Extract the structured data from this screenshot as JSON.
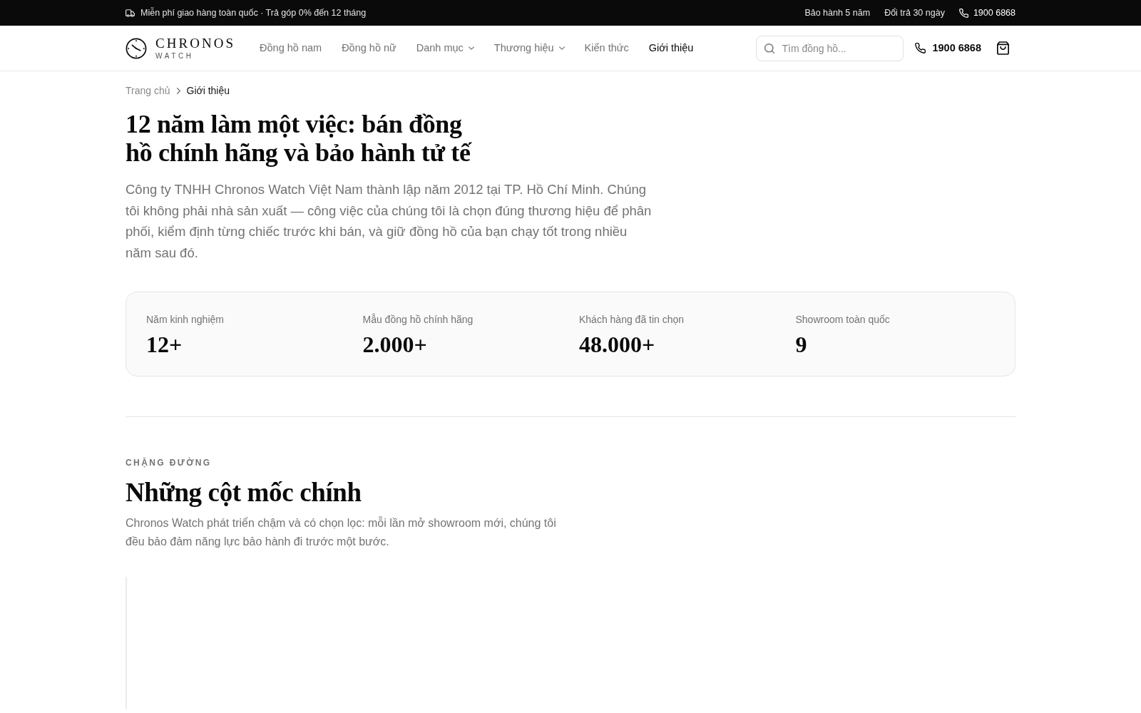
{
  "top_bar": {
    "promo": "Miễn phí giao hàng toàn quốc · Trả góp 0% đến 12 tháng",
    "links": [
      "Bảo hành 5 năm",
      "Đổi trả 30 ngày"
    ],
    "phone": "1900 6868"
  },
  "header": {
    "logo": {
      "name": "CHRONOS",
      "tagline": "WATCH"
    },
    "nav": [
      {
        "label": "Đồng hồ nam",
        "kind": "link",
        "selected": false
      },
      {
        "label": "Đồng hồ nữ",
        "kind": "link",
        "selected": false
      },
      {
        "label": "Danh mục",
        "kind": "dropdown",
        "selected": false
      },
      {
        "label": "Thương hiệu",
        "kind": "dropdown",
        "selected": false
      },
      {
        "label": "Kiến thức",
        "kind": "link",
        "selected": false
      },
      {
        "label": "Giới thiệu",
        "kind": "link",
        "selected": true
      }
    ],
    "search": {
      "placeholder": "Tìm đồng hồ..."
    },
    "phone": "1900 6868"
  },
  "breadcrumb": [
    {
      "label": "Trang chủ",
      "current": false
    },
    {
      "label": "Giới thiệu",
      "current": true
    }
  ],
  "hero": {
    "title": "12 năm làm một việc: bán đồng hồ chính hãng và bảo hành tử tế",
    "intro": "Công ty TNHH Chronos Watch Việt Nam thành lập năm 2012 tại TP. Hồ Chí Minh. Chúng tôi không phải nhà sản xuất — công việc của chúng tôi là chọn đúng thương hiệu để phân phối, kiểm định từng chiếc trước khi bán, và giữ đồng hồ của bạn chạy tốt trong nhiều năm sau đó."
  },
  "stats": [
    {
      "label": "Năm kinh nghiệm",
      "value": "12+"
    },
    {
      "label": "Mẫu đồng hồ chính hãng",
      "value": "2.000+"
    },
    {
      "label": "Khách hàng đã tin chọn",
      "value": "48.000+"
    },
    {
      "label": "Showroom toàn quốc",
      "value": "9"
    }
  ],
  "milestones": {
    "eyebrow": "CHẶNG ĐƯỜNG",
    "title": "Những cột mốc chính",
    "description": "Chronos Watch phát triển chậm và có chọn lọc: mỗi lần mở showroom mới, chúng tôi đều bảo đảm năng lực bảo hành đi trước một bước."
  }
}
